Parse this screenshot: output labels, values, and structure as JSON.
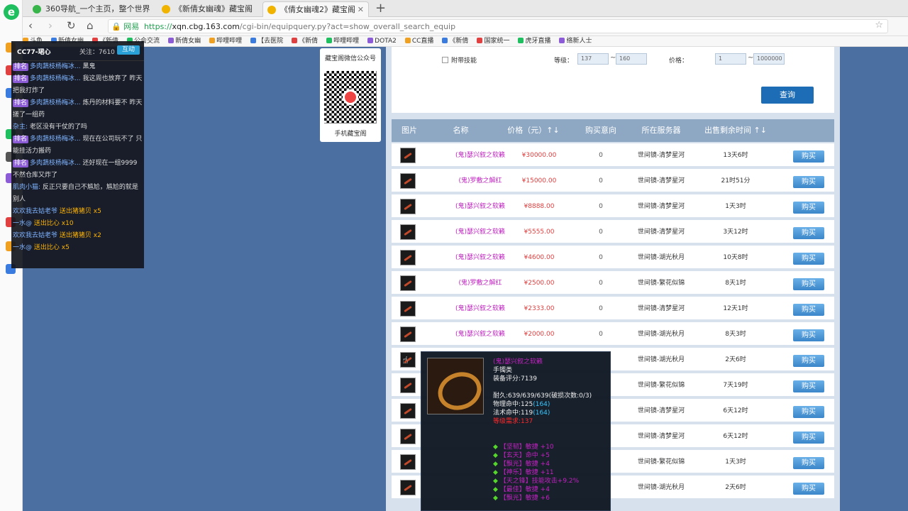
{
  "browser": {
    "tabs": [
      {
        "label": "360导航_一个主页，整个世界",
        "icon": "360-icon"
      },
      {
        "label": "《新倩女幽魂》藏宝阁",
        "icon": "cbg-icon"
      },
      {
        "label": "《倩女幽魂2》藏宝阁",
        "icon": "cbg-icon",
        "active": true
      }
    ],
    "new_tab": "+",
    "secure_label": "网易",
    "url_scheme": "https://",
    "url_host": "xqn.cbg.163.com",
    "url_path": "/cgi-bin/equipquery.py?act=show_overall_search_equip",
    "bookmarks": [
      "斗鱼",
      "新倩女幽",
      "《新倩",
      "公会交流",
      "新倩女幽",
      "哔哩哔哩",
      "【去医院",
      "《新倩",
      "哔哩哔哩",
      "DOTA2",
      "CC直播",
      "《新倩",
      "国家统一",
      "虎牙直播",
      "络新人士"
    ]
  },
  "chat": {
    "streamer": "CC77-珺心",
    "follow": "关注：7610",
    "follow_btn": "互动",
    "lines": [
      {
        "user": "多肉蔬枝杨梅冰...",
        "text": "黑鬼",
        "lvl": "排名"
      },
      {
        "user": "多肉蔬枝杨梅冰...",
        "text": "我这周也放弃了 昨天把我打炸了",
        "lvl": "排名"
      },
      {
        "user": "多肉蔬枝杨梅冰...",
        "text": "炼丹的材料要不 昨天搓了一组药",
        "lvl": "排名"
      },
      {
        "user": "杂主:",
        "text": "老区没有干仗的了吗",
        "lvl": ""
      },
      {
        "user": "多肉蔬枝杨梅冰...",
        "text": "现在在公司玩不了 只能挂活力搬药",
        "lvl": "排名"
      },
      {
        "user": "多肉蔬枝杨梅冰...",
        "text": "还好现在一组9999不然仓库又炸了",
        "lvl": "排名"
      },
      {
        "user": "肌肉小猫:",
        "text": "反正只要自己不尴尬，尴尬的就是别人",
        "lvl": ""
      },
      {
        "user": "欢欢我去姑老爷",
        "text": "送出猪猪贝",
        "gift": "x5"
      },
      {
        "user": "一水@",
        "text": "送出比心",
        "gift": "x10"
      },
      {
        "user": "欢欢我去姑老爷",
        "text": "送出猪猪贝",
        "gift": "x2"
      },
      {
        "user": "一水@",
        "text": "送出比心",
        "gift": "x5"
      }
    ]
  },
  "qr": {
    "top_label": "藏宝阁微信公众号",
    "bottom_label": "手机藏宝阁"
  },
  "search": {
    "checkbox": "附带技能",
    "level_label": "等级：",
    "level_min": "137",
    "level_max": "160",
    "price_label": "价格：",
    "price_min": "1",
    "price_max": "1000000",
    "dash": "~",
    "query": "查询"
  },
  "table": {
    "headers": [
      "图片",
      "名称",
      "价格（元）↑↓",
      "购买意向",
      "所在服务器",
      "出售剩余时间 ↑↓"
    ],
    "buy_label": "购买",
    "rows": [
      {
        "name": "(鬼)瑟兴叙之软籁",
        "price": "¥30000.00",
        "count": "0",
        "server": "世间镜-清梦星河",
        "time": "13天6时"
      },
      {
        "name": "(鬼)罗敷之解红",
        "price": "¥15000.00",
        "count": "0",
        "server": "世间镜-清梦星河",
        "time": "21时51分"
      },
      {
        "name": "(鬼)瑟兴叙之软籁",
        "price": "¥8888.00",
        "count": "0",
        "server": "世间镜-清梦星河",
        "time": "1天3时"
      },
      {
        "name": "(鬼)瑟兴叙之软籁",
        "price": "¥5555.00",
        "count": "0",
        "server": "世间镜-清梦星河",
        "time": "3天12时"
      },
      {
        "name": "(鬼)瑟兴叙之软籁",
        "price": "¥4600.00",
        "count": "0",
        "server": "世间镜-湖光秋月",
        "time": "10天8时"
      },
      {
        "name": "(鬼)罗敷之解红",
        "price": "¥2500.00",
        "count": "0",
        "server": "世间镜-繁花似锦",
        "time": "8天1时"
      },
      {
        "name": "(鬼)瑟兴叙之软籁",
        "price": "¥2333.00",
        "count": "0",
        "server": "世间镜-清梦星河",
        "time": "12天1时"
      },
      {
        "name": "(鬼)瑟兴叙之软籁",
        "price": "¥2000.00",
        "count": "0",
        "server": "世间镜-湖光秋月",
        "time": "8天3时"
      },
      {
        "name": "",
        "price": "",
        "count": "",
        "server": "世间镜-湖光秋月",
        "time": "2天6时"
      },
      {
        "name": "",
        "price": "",
        "count": "",
        "server": "世间镜-繁花似锦",
        "time": "7天19时"
      },
      {
        "name": "",
        "price": "",
        "count": "",
        "server": "世间镜-清梦星河",
        "time": "6天12时"
      },
      {
        "name": "",
        "price": "",
        "count": "",
        "server": "世间镜-清梦星河",
        "time": "6天12时"
      },
      {
        "name": "",
        "price": "",
        "count": "",
        "server": "世间镜-繁花似锦",
        "time": "1天3时"
      },
      {
        "name": "",
        "price": "",
        "count": "",
        "server": "世间镜-湖光秋月",
        "time": "2天6时"
      }
    ]
  },
  "tooltip": {
    "title": "(鬼)瑟兴叙之软籁",
    "type": "手镯类",
    "score": "装备评分:7139",
    "durability": "耐久:639/639/639(破损次数:0/3)",
    "phys_label": "物理命中:125",
    "phys_bonus": "(164)",
    "magic_label": "法术命中:119",
    "magic_bonus": "(164)",
    "req": "等级需求:137",
    "mods": [
      "【坚韧】敏捷 +10",
      "【玄天】命中 +5",
      "【飘光】敏捷 +4",
      "【神乐】敏捷 +11",
      "【天之锋】技能攻击+9.2%",
      "【最佳】敏捷 +4",
      "【飘光】敏捷 +6"
    ]
  },
  "colors": {
    "bg": "#4a6fa0",
    "header": "#8ea8c4",
    "name": "#c022c0",
    "price": "#e23d3d",
    "button": "#3b86c9"
  }
}
